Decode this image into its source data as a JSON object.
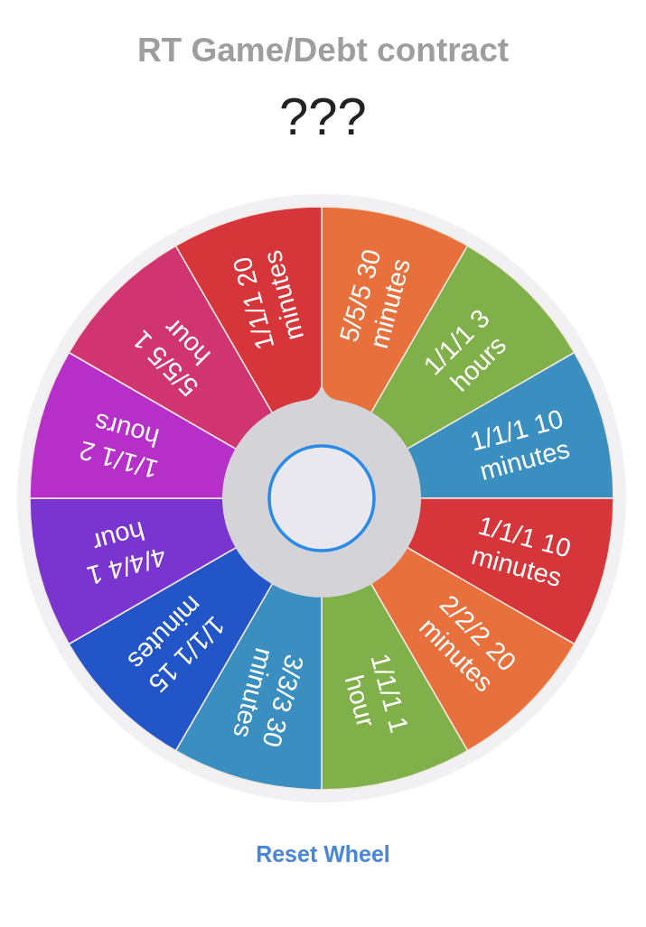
{
  "title": "RT Game/Debt contract",
  "result": "???",
  "segments": [
    {
      "lines": [
        "5/5/5 30",
        "minutes"
      ],
      "color": "#e8703c"
    },
    {
      "lines": [
        "1/1/1 3",
        "hours"
      ],
      "color": "#80b04a"
    },
    {
      "lines": [
        "1/1/1 10",
        "minutes"
      ],
      "color": "#3a8fc0"
    },
    {
      "lines": [
        "1/1/1 10",
        "minutes"
      ],
      "color": "#d63539"
    },
    {
      "lines": [
        "2/2/2 20",
        "minutes"
      ],
      "color": "#e8703c"
    },
    {
      "lines": [
        "1/1/1 1",
        "hour"
      ],
      "color": "#80b04a"
    },
    {
      "lines": [
        "3/3/3 30",
        "minutes"
      ],
      "color": "#3a8fc0"
    },
    {
      "lines": [
        "1/1/1 15",
        "minutes"
      ],
      "color": "#2155c8"
    },
    {
      "lines": [
        "4/4/4 1",
        "hour"
      ],
      "color": "#7a35d0"
    },
    {
      "lines": [
        "1/1/1 2",
        "hours"
      ],
      "color": "#b52fc8"
    },
    {
      "lines": [
        "5/5/5 1",
        "hour"
      ],
      "color": "#d03572"
    },
    {
      "lines": [
        "1/1/1 20",
        "minutes"
      ],
      "color": "#d63539"
    }
  ],
  "reset_button": "Reset Wheel"
}
